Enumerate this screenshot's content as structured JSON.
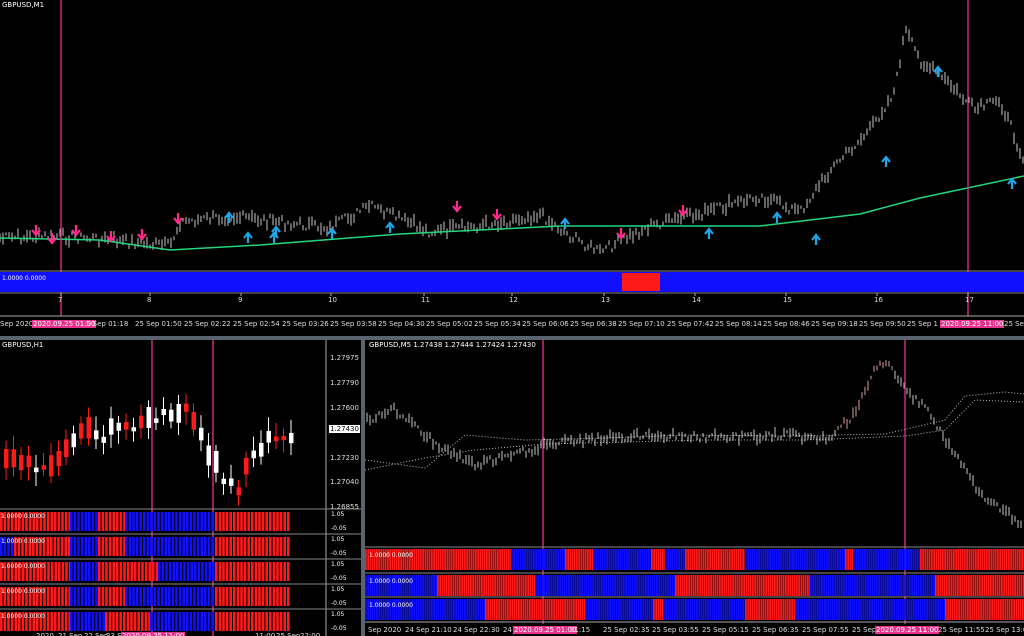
{
  "colors": {
    "bg": "#000000",
    "candle": "#c8c8c8",
    "ma": "#22d67e",
    "arrow_up": "#1ea6e8",
    "arrow_down": "#ff2a8c",
    "vline": "#e8328c",
    "blue": "#1010ff",
    "red": "#ff1a1a",
    "axis": "#ffffff"
  },
  "top": {
    "title": "GBPUSD,M1",
    "indicator_label": "1.0000 0.0000",
    "day_numbers": [
      "7",
      "8",
      "9",
      "10",
      "11",
      "12",
      "13",
      "14",
      "15",
      "16",
      "17"
    ],
    "time_labels": [
      "Sep 2020",
      "2020.09.25 01:00",
      "5 Sep 01:18",
      "25 Sep 01:50",
      "25 Sep 02:22",
      "25 Sep 02:54",
      "25 Sep 03:26",
      "25 Sep 03:58",
      "25 Sep 04:30",
      "25 Sep 05:02",
      "25 Sep 05:34",
      "25 Sep 06:06",
      "25 Sep 06:38",
      "25 Sep 07:10",
      "25 Sep 07:42",
      "25 Sep 08:14",
      "25 Sep 08:46",
      "25 Sep 09:18",
      "25 Sep 09:50",
      "25 Sep 1",
      "2020.09.25 11:00",
      "25 Se"
    ]
  },
  "bl": {
    "title": "GBPUSD,H1",
    "prices": [
      "1.27975",
      "1.27790",
      "1.27600",
      "1.27430",
      "1.27230",
      "1.27040",
      "1.26855"
    ],
    "price_current": "1.27430",
    "rows": [
      {
        "label": "1.0000 0.0000",
        "scale_top": "1.05",
        "scale_bot": "-0.05"
      },
      {
        "label": "1.0000 0.0000",
        "scale_top": "1.05",
        "scale_bot": "-0.05"
      },
      {
        "label": "1.0000 0.0000",
        "scale_top": "1.05",
        "scale_bot": "-0.05"
      },
      {
        "label": "1.0000 0.0000",
        "scale_top": "1.05",
        "scale_bot": "-0.05"
      },
      {
        "label": "1.0000 0.0000",
        "scale_top": "1.05",
        "scale_bot": "-0.05"
      }
    ],
    "time_labels": [
      "2020",
      "21 Sep",
      "22 Sep",
      "23 Sep",
      "2020.09.25 11:00",
      "11:00",
      "25 Sep",
      "22:00"
    ]
  },
  "br": {
    "title": "GBPUSD,M5  1.27438 1.27444 1.27424 1.27430",
    "rows": [
      {
        "label": "1.0000 0.0000"
      },
      {
        "label": "1.0000 0.0000"
      },
      {
        "label": "1.0000 0.0000"
      }
    ],
    "time_labels": [
      "Sep 2020",
      "24 Sep 21:10",
      "24 Sep 22:30",
      "24",
      "2020.09.25 01:00",
      "01:15",
      "25 Sep 02:35",
      "25 Sep 03:55",
      "25 Sep 05:15",
      "25 Sep 06:35",
      "25 Sep 07:55",
      "25 Sep 09:",
      "2020.09.25 11:00",
      "25 Sep 11:55",
      "25 Sep 13:0"
    ]
  }
}
